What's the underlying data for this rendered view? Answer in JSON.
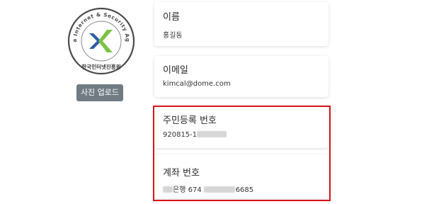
{
  "logo": {
    "ring_text": "Korea Internet & Security Agency",
    "name_text": "한국인터넷진흥원",
    "colors": {
      "blue": "#2a5fa8",
      "green": "#7cc242",
      "ring": "#4a4a4a"
    }
  },
  "upload_label": "사진 업로드",
  "fields": {
    "name": {
      "label": "이름",
      "value": "홍길동"
    },
    "email": {
      "label": "이메일",
      "value": "kimcal@dome.com"
    },
    "rrn": {
      "label": "주민등록 번호",
      "value_prefix": "920815-1"
    },
    "account": {
      "label": "계좌 번호",
      "bank_suffix": "은행",
      "num_a": "674",
      "num_b": "6685"
    }
  },
  "highlight_color": "#d9131a"
}
